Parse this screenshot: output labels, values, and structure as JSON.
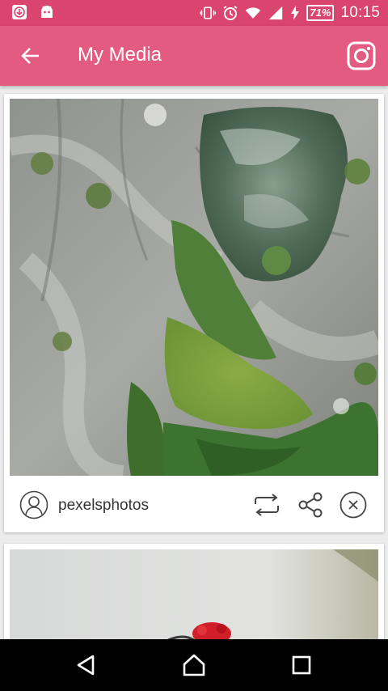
{
  "status_bar": {
    "battery": "71%",
    "time": "10:15",
    "icons": [
      "download-icon",
      "android-icon",
      "vibrate-icon",
      "alarm-icon",
      "wifi-icon",
      "signal-icon",
      "charging-icon"
    ]
  },
  "app_bar": {
    "title": "My Media",
    "back_icon": "arrow-left-icon",
    "action_icon": "instagram-icon",
    "color": "#e45b82",
    "status_color": "#d9456e"
  },
  "posts": [
    {
      "username": "pexelsphotos",
      "actions": [
        "repost-icon",
        "share-icon",
        "close-icon"
      ]
    }
  ],
  "nav": [
    "back-triangle-icon",
    "home-icon",
    "recents-icon"
  ]
}
